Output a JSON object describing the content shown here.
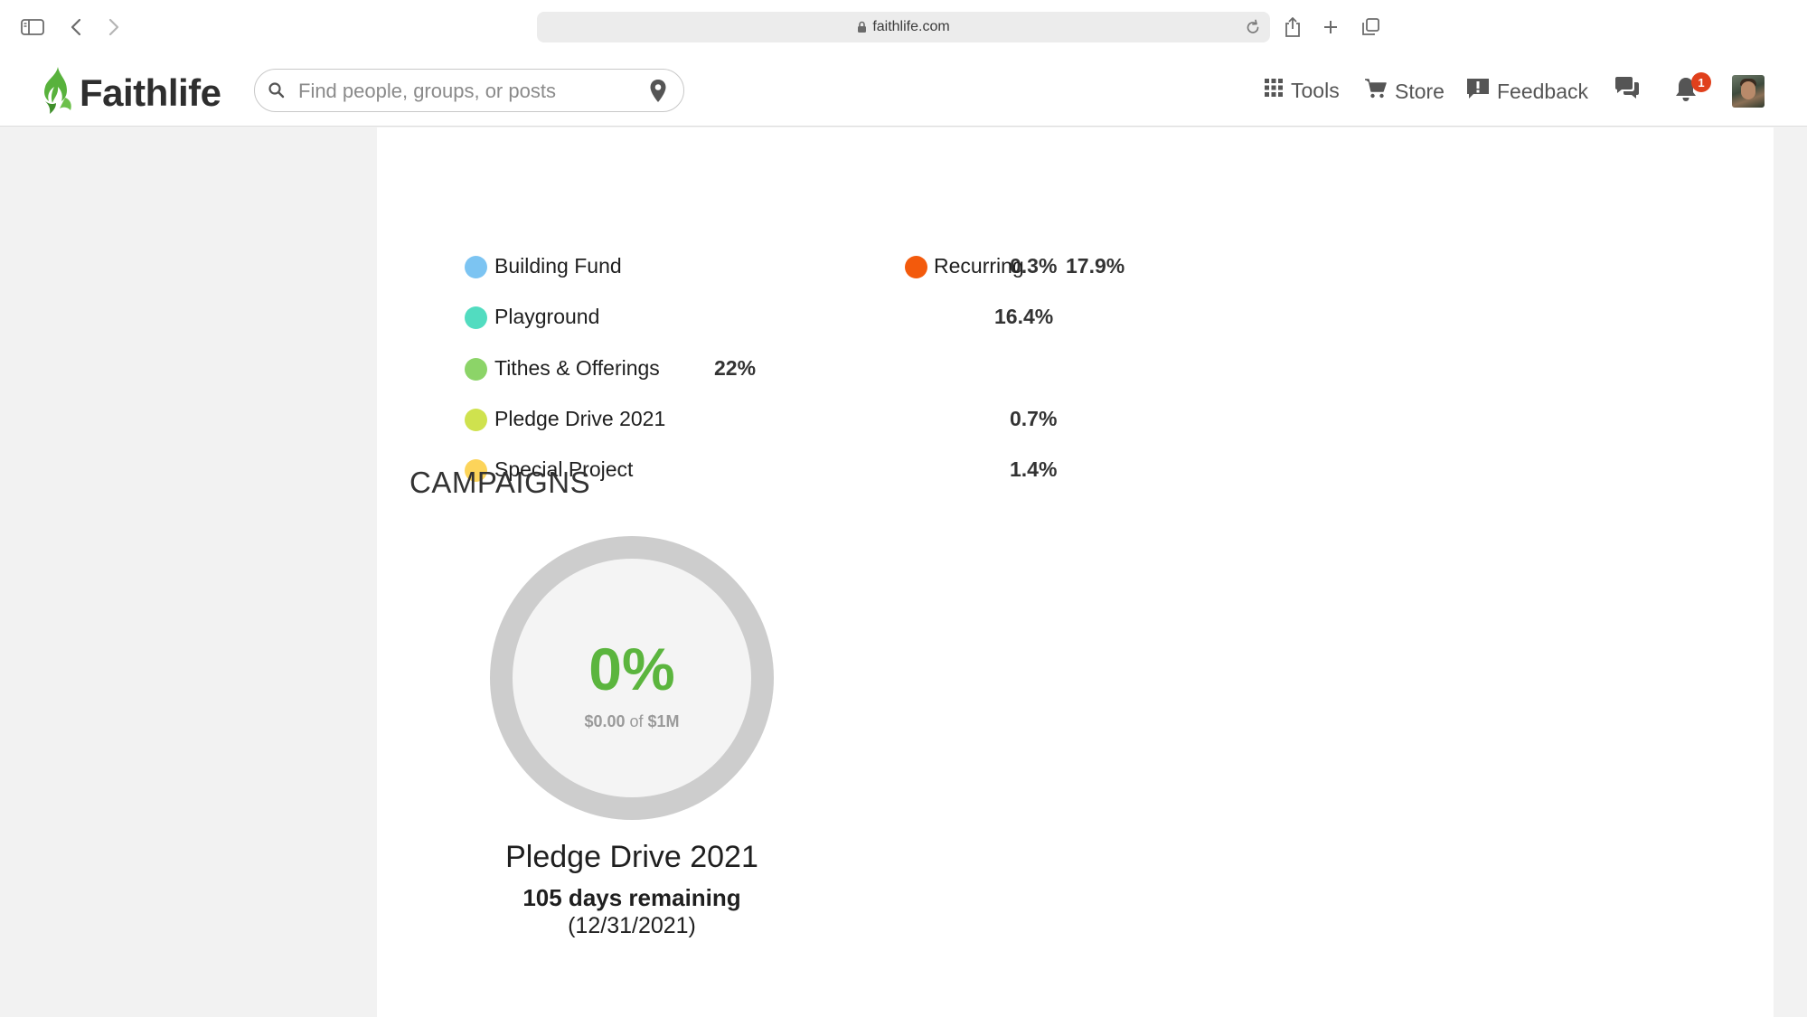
{
  "browser": {
    "url": "faithlife.com"
  },
  "header": {
    "logo_text": "Faithlife",
    "search_placeholder": "Find people, groups, or posts",
    "nav": {
      "tools": "Tools",
      "store": "Store",
      "feedback": "Feedback"
    },
    "notification_count": "1"
  },
  "fund_breakdown": {
    "left": [
      {
        "label": "Building Fund",
        "percent": "0.3%",
        "color": "#7cc4f2"
      },
      {
        "label": "Playground",
        "percent": "16.4%",
        "color": "#52dcc0"
      },
      {
        "label": "Tithes & Offerings",
        "percent": "22%",
        "color": "#8cd468"
      },
      {
        "label": "Pledge Drive 2021",
        "percent": "0.7%",
        "color": "#cfe24e"
      },
      {
        "label": "Special Project",
        "percent": "1.4%",
        "color": "#fcd45a"
      }
    ],
    "right": [
      {
        "label": "Recurring",
        "percent": "17.9%",
        "color": "#f35a0c"
      }
    ]
  },
  "campaigns": {
    "title": "CAMPAIGNS",
    "items": [
      {
        "percent_text": "0%",
        "raised": "$0.00",
        "of_text": "of",
        "goal": "$1M",
        "name": "Pledge Drive 2021",
        "remaining": "105 days remaining",
        "end_date": "(12/31/2021)",
        "progress": 0,
        "accent_color": "#5bb53e"
      }
    ]
  }
}
